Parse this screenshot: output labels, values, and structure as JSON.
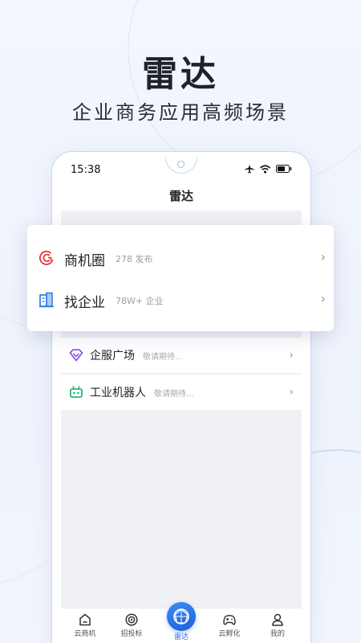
{
  "hero": {
    "title": "雷达",
    "subtitle": "企业商务应用高频场景"
  },
  "statusbar": {
    "time": "15:38",
    "icons": [
      "airplane-icon",
      "wifi-icon",
      "battery-icon"
    ]
  },
  "navbar": {
    "title": "雷达"
  },
  "popup": {
    "items": [
      {
        "label": "商机圈",
        "sub": "278 发布",
        "icon": "refresh-circle-icon",
        "color": "#e5363b"
      },
      {
        "label": "找企业",
        "sub": "78W+ 企业",
        "icon": "buildings-icon",
        "color": "#2f7be5"
      }
    ]
  },
  "list": {
    "items": [
      {
        "label": "企服广场",
        "sub": "敬请期待...",
        "icon": "diamond-icon",
        "color": "#8a4fe0"
      },
      {
        "label": "工业机器人",
        "sub": "敬请期待...",
        "icon": "robot-icon",
        "color": "#2bb673"
      }
    ]
  },
  "tabbar": {
    "items": [
      {
        "label": "云商机",
        "icon": "home-icon"
      },
      {
        "label": "招投标",
        "icon": "target-icon"
      },
      {
        "label": "雷达",
        "icon": "radar-icon",
        "active": true
      },
      {
        "label": "云孵化",
        "icon": "gamepad-icon"
      },
      {
        "label": "我的",
        "icon": "user-icon"
      }
    ],
    "accent": "#2f6fe0"
  }
}
